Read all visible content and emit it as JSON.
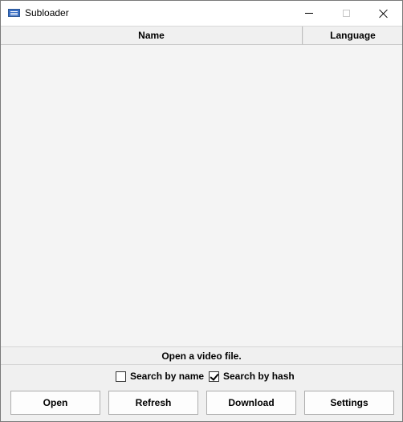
{
  "window": {
    "title": "Subloader",
    "icon": "keyboard-app-icon",
    "controls": [
      "minimize-icon",
      "maximize-icon",
      "close-icon"
    ]
  },
  "list": {
    "columns": [
      {
        "label": "Name"
      },
      {
        "label": "Language"
      }
    ],
    "rows": []
  },
  "status": {
    "text": "Open a video file."
  },
  "options": {
    "search_by_name": {
      "label": "Search by name",
      "checked": false
    },
    "search_by_hash": {
      "label": "Search by hash",
      "checked": true
    }
  },
  "buttons": {
    "open": "Open",
    "refresh": "Refresh",
    "download": "Download",
    "settings": "Settings"
  }
}
